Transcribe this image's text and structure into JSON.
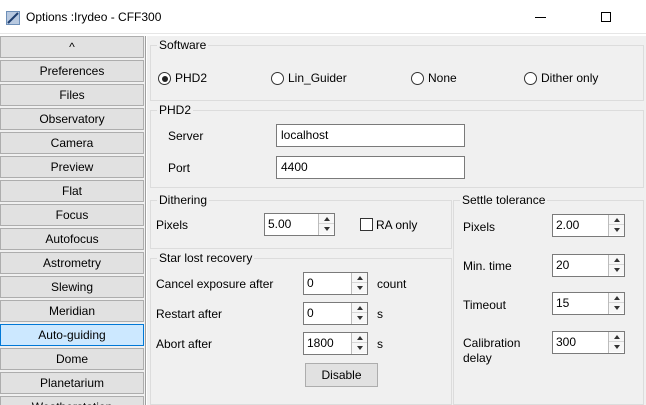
{
  "window": {
    "title": "Options :Irydeo - CFF300"
  },
  "sidebar": {
    "scroll_up": "^",
    "items": [
      {
        "label": "Preferences"
      },
      {
        "label": "Files"
      },
      {
        "label": "Observatory"
      },
      {
        "label": "Camera"
      },
      {
        "label": "Preview"
      },
      {
        "label": "Flat"
      },
      {
        "label": "Focus"
      },
      {
        "label": "Autofocus"
      },
      {
        "label": "Astrometry"
      },
      {
        "label": "Slewing"
      },
      {
        "label": "Meridian"
      },
      {
        "label": "Auto-guiding",
        "active": true
      },
      {
        "label": "Dome"
      },
      {
        "label": "Planetarium"
      },
      {
        "label": "Weatherstation"
      }
    ]
  },
  "software": {
    "title": "Software",
    "options": [
      {
        "label": "PHD2",
        "checked": true
      },
      {
        "label": "Lin_Guider",
        "checked": false
      },
      {
        "label": "None",
        "checked": false
      },
      {
        "label": "Dither only",
        "checked": false
      }
    ]
  },
  "phd2": {
    "title": "PHD2",
    "server_label": "Server",
    "server_value": "localhost",
    "port_label": "Port",
    "port_value": "4400"
  },
  "dithering": {
    "title": "Dithering",
    "pixels_label": "Pixels",
    "pixels_value": "5.00",
    "ra_only_label": "RA only",
    "ra_only_checked": false
  },
  "star_lost": {
    "title": "Star lost recovery",
    "cancel_label": "Cancel exposure after",
    "cancel_value": "0",
    "cancel_unit": "count",
    "restart_label": "Restart after",
    "restart_value": "0",
    "restart_unit": "s",
    "abort_label": "Abort after",
    "abort_value": "1800",
    "abort_unit": "s",
    "disable_button": "Disable"
  },
  "settle": {
    "title": "Settle tolerance",
    "pixels_label": "Pixels",
    "pixels_value": "2.00",
    "min_time_label": "Min. time",
    "min_time_value": "20",
    "timeout_label": "Timeout",
    "timeout_value": "15",
    "calib_label_line1": "Calibration",
    "calib_label_line2": "delay",
    "calib_value": "300"
  }
}
